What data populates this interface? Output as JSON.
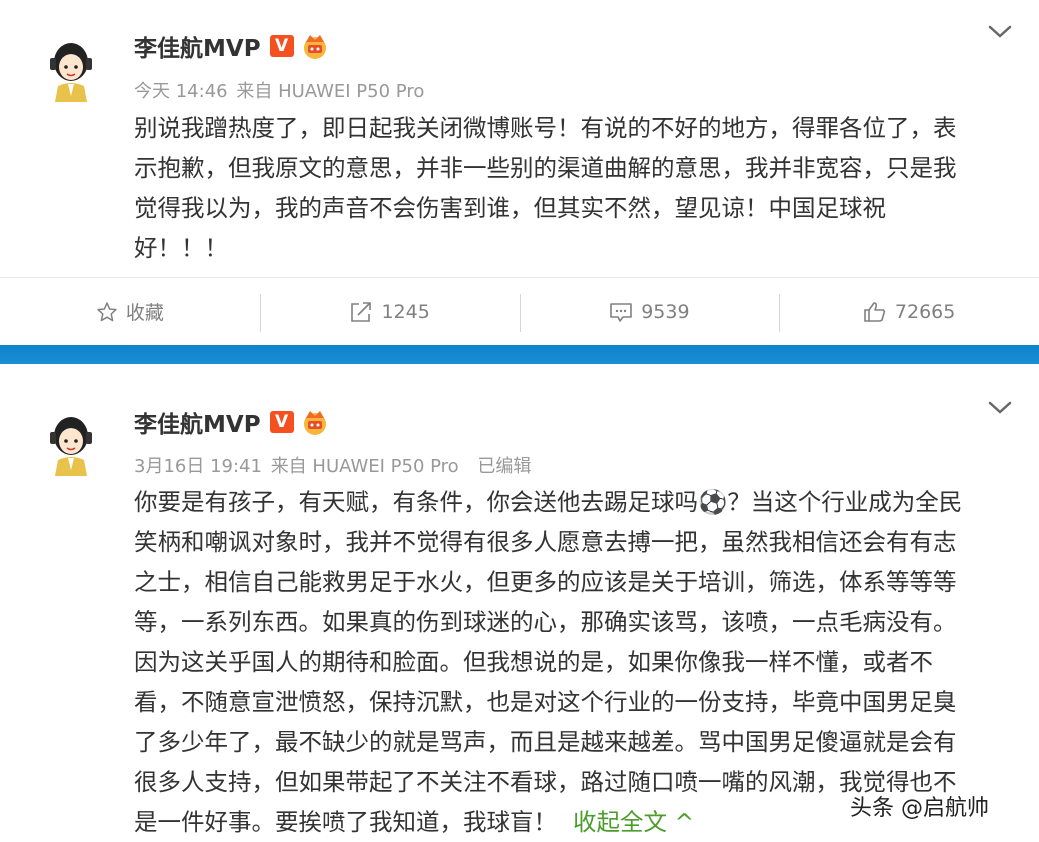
{
  "posts": [
    {
      "author": "李佳航MVP",
      "verified_badge": "V",
      "time": "今天 14:46",
      "source": "来自 HUAWEI P50 Pro",
      "edited": "",
      "content_lines": [
        "别说我蹭热度了，即日起我关闭微博账号！有说的不好的地方，得罪各位了，表",
        "示抱歉，但我原文的意思，并非一些别的渠道曲解的意思，我并非宽容，只是我",
        "觉得我以为，我的声音不会伤害到谁，但其实不然，望见谅！中国足球祝",
        "好！！！"
      ],
      "actions": {
        "favorite": "收藏",
        "repost": "1245",
        "comment": "9539",
        "like": "72665"
      }
    },
    {
      "author": "李佳航MVP",
      "verified_badge": "V",
      "time": "3月16日 19:41",
      "source": "来自 HUAWEI P50 Pro",
      "edited": "已编辑",
      "content_lines": [
        "你要是有孩子，有天赋，有条件，你会送他去踢足球吗⚽？当这个行业成为全民",
        "笑柄和嘲讽对象时，我并不觉得有很多人愿意去搏一把，虽然我相信还会有有志",
        "之士，相信自己能救男足于水火，但更多的应该是关于培训，筛选，体系等等等",
        "等，一系列东西。如果真的伤到球迷的心，那确实该骂，该喷，一点毛病没有。",
        "因为这关乎国人的期待和脸面。但我想说的是，如果你像我一样不懂，或者不",
        "看，不随意宣泄愤怒，保持沉默，也是对这个行业的一份支持，毕竟中国男足臭",
        "了多少年了，最不缺少的就是骂声，而且是越来越差。骂中国男足傻逼就是会有",
        "很多人支持，但如果带起了不关注不看球，路过随口喷一嘴的风潮，我觉得也不",
        "是一件好事。要挨喷了我知道，我球盲！"
      ],
      "collapse_label": "收起全文 ^"
    }
  ],
  "watermark": "头条 @启航帅",
  "colors": {
    "accent_blue": "#1a8fd6",
    "badge_orange": "#f5501f",
    "link_green": "#4a9d2a"
  }
}
